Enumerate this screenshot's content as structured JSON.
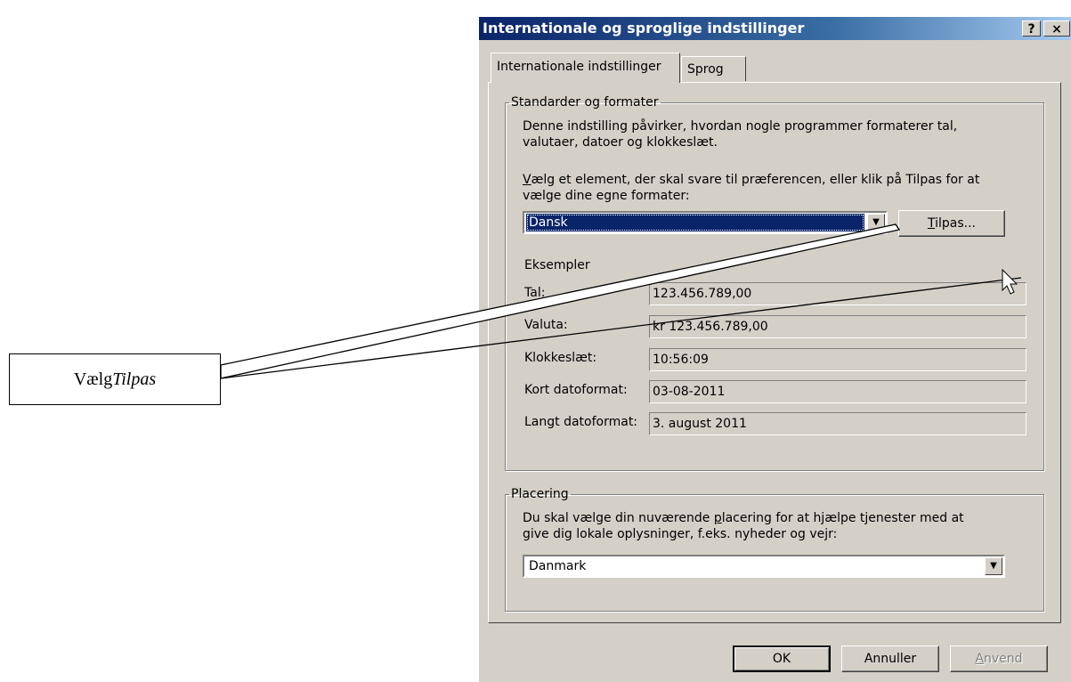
{
  "callout": {
    "prefix": "Vælg ",
    "italic": "Tilpas"
  },
  "dialog": {
    "title": "Internationale og sproglige indstillinger",
    "help_glyph": "?",
    "close_glyph": "×",
    "tabs": [
      {
        "label": "Internationale indstillinger",
        "active": true
      },
      {
        "label": "Sprog",
        "active": false
      }
    ],
    "standards": {
      "legend": "Standarder og formater",
      "description_line1": "Denne indstilling påvirker, hvordan nogle programmer formaterer tal,",
      "description_line2": "valutaer, datoer og klokkeslæt.",
      "instruction_first": "V",
      "instruction_line1_rest": "ælg et element, der skal svare til præferencen, eller klik på Tilpas for at",
      "instruction_line2": "vælge dine egne formater:",
      "selected_value": "Dansk",
      "customize_first": "T",
      "customize_rest": "ilpas...",
      "examples_label": "Eksempler",
      "examples": [
        {
          "label": "Tal:",
          "value": "123.456.789,00"
        },
        {
          "label": "Valuta:",
          "value": "kr 123.456.789,00"
        },
        {
          "label": "Klokkeslæt:",
          "value": "10:56:09"
        },
        {
          "label": "Kort datoformat:",
          "value": "03-08-2011"
        },
        {
          "label": "Langt datoformat:",
          "value": "3. august 2011"
        }
      ]
    },
    "location": {
      "legend": "Placering",
      "description_line1_a": "Du skal vælge din nuværende ",
      "description_line1_u": "p",
      "description_line1_b": "lacering for at hjælpe tjenester med at",
      "description_line2": "give dig lokale oplysninger, f.eks. nyheder og vejr:",
      "selected_value": "Danmark"
    },
    "buttons": {
      "ok": "OK",
      "cancel": "Annuller",
      "apply_first": "A",
      "apply_rest": "nvend",
      "apply_enabled": false
    }
  },
  "colors": {
    "face": "#d4d0c8",
    "titlebar_start": "#0a246a",
    "titlebar_end": "#a6caf0",
    "selection": "#0a246a"
  },
  "icons": [
    "help-icon",
    "close-icon",
    "dropdown-arrow-icon",
    "mouse-cursor-icon"
  ]
}
